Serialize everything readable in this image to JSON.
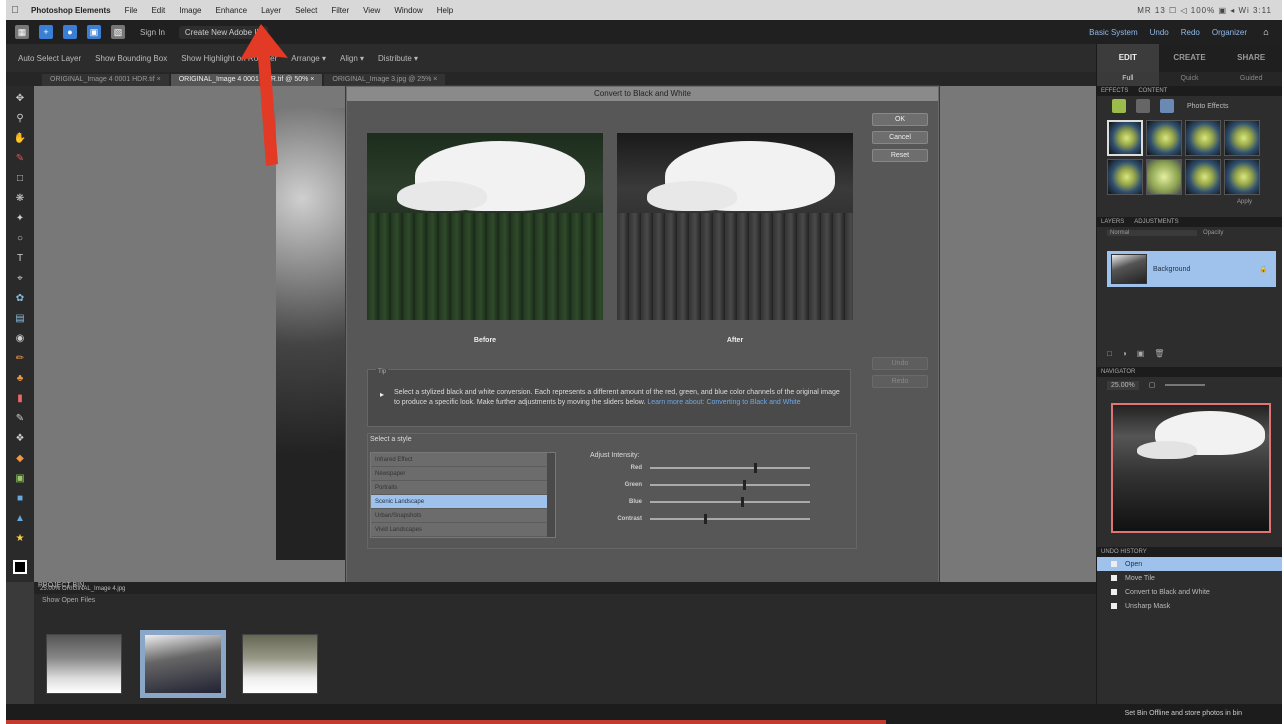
{
  "menubar": {
    "app": "Photoshop Elements",
    "items": [
      "File",
      "Edit",
      "Image",
      "Enhance",
      "Layer",
      "Select",
      "Filter",
      "View",
      "Window",
      "Help"
    ],
    "status": "MR 13 ☐ ◁ 100% ▣ ◂ Wi 3:11"
  },
  "apptoolbar": {
    "signin": "Sign In",
    "create": "Create New Adobe ID",
    "right_items": [
      "Basic System",
      "Undo",
      "Redo",
      "Organizer"
    ]
  },
  "options": {
    "items": [
      "Auto Select Layer",
      "Show Bounding Box",
      "Show Highlight on Rollover",
      "Arrange ▾",
      "Align ▾",
      "Distribute ▾"
    ]
  },
  "doc_tabs": [
    "ORIGINAL_Image 4 0001 HDR.tif ×",
    "ORIGINAL_Image 4 0001 HDR.tif @ 50% ×",
    "ORIGINAL_Image 3.jpg @ 25% ×"
  ],
  "dialog": {
    "title": "Convert to Black and White",
    "buttons": {
      "ok": "OK",
      "cancel": "Cancel",
      "reset": "Reset",
      "undo": "Undo",
      "redo": "Redo"
    },
    "before_label": "Before",
    "after_label": "After",
    "tip_title": "Tip",
    "tip_text": "Select a stylized black and white conversion. Each represents a different amount of the red, green, and blue color channels of the original image to produce a specific look. Make further adjustments by moving the sliders below.",
    "tip_link": "Learn more about: Converting to Black and White",
    "style_title": "Select a style",
    "styles": [
      "Infrared Effect",
      "Newspaper",
      "Portraits",
      "Scenic Landscape",
      "Urban/Snapshots",
      "Vivid Landscapes"
    ],
    "selected_style": 3,
    "adjust_title": "Adjust Intensity:",
    "sliders": [
      {
        "label": "Red",
        "value": 0.65
      },
      {
        "label": "Green",
        "value": 0.58
      },
      {
        "label": "Blue",
        "value": 0.57
      },
      {
        "label": "Contrast",
        "value": 0.34
      }
    ]
  },
  "rpanel": {
    "tabs": [
      "EDIT",
      "CREATE",
      "SHARE"
    ],
    "subtabs": [
      "Full",
      "Quick",
      "Guided"
    ],
    "effects_header": [
      "EFFECTS",
      "CONTENT"
    ],
    "effects_filter": "Photo Effects",
    "effects_more": "Apply",
    "layers_header": [
      "LAYERS",
      "ADJUSTMENTS"
    ],
    "layers_mode": "Normal",
    "layers_opacity": "Opacity",
    "layer_name": "Background",
    "navigator_header": "NAVIGATOR",
    "nav_zoom": "25.00%",
    "history_header": "UNDO HISTORY",
    "history": [
      "Open",
      "Move Tile",
      "Convert to Black and White",
      "Unsharp Mask"
    ],
    "history_selected": 0
  },
  "bin": {
    "zoom": "25.00%  ORIGINAL_Image 4.jpg",
    "title": "PROJECT BIN",
    "show": "Show Open Files"
  },
  "status": {
    "text": "Set Bin Offline and store photos in bin"
  }
}
